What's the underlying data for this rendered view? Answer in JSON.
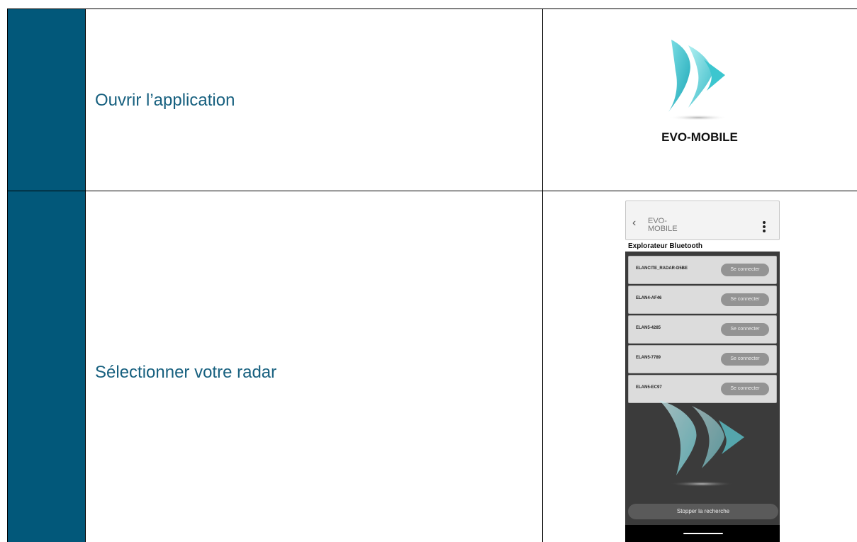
{
  "steps": [
    {
      "label": "Ouvrir l’application"
    },
    {
      "label": "Sélectionner votre radar"
    }
  ],
  "logo": {
    "caption": "EVO-MOBILE"
  },
  "phone": {
    "app_title": "EVO-\nMOBILE",
    "subtitle": "Explorateur Bluetooth",
    "devices": [
      {
        "name": "ELANCITE_RADAR-D5BE",
        "action": "Se connecter"
      },
      {
        "name": "ELAN4-AF46",
        "action": "Se connecter"
      },
      {
        "name": "ELAN5-4285",
        "action": "Se connecter"
      },
      {
        "name": "ELAN5-7789",
        "action": "Se connecter"
      },
      {
        "name": "ELAN5-EC97",
        "action": "Se connecter"
      }
    ],
    "stop_label": "Stopper la recherche"
  },
  "colors": {
    "stripe": "#02587a",
    "step_text": "#17607f",
    "logo_teal": "#26b8c4"
  }
}
